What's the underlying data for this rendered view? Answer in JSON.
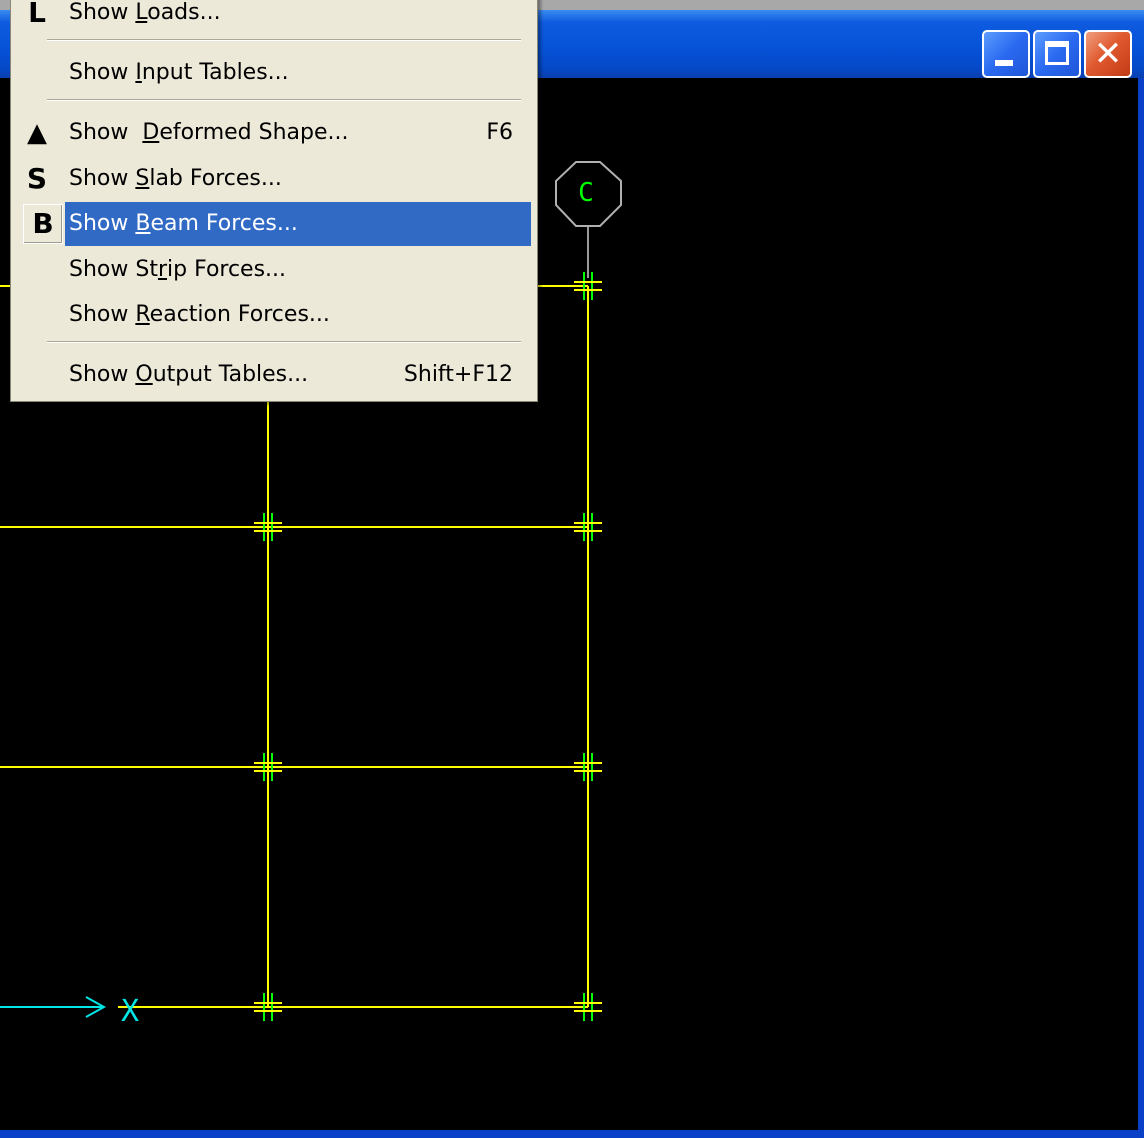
{
  "window": {
    "controls": {
      "minimize": "minimize-icon",
      "maximize": "maximize-icon",
      "close": "close-icon"
    }
  },
  "menu": {
    "items": [
      {
        "pre": "Show ",
        "ul": "L",
        "post": "oads...",
        "shortcut": "",
        "icon": "L"
      },
      {
        "pre": "Show ",
        "ul": "I",
        "post": "nput Tables...",
        "shortcut": "",
        "icon": ""
      },
      {
        "pre": "Show  ",
        "ul": "D",
        "post": "eformed Shape...",
        "shortcut": "F6",
        "icon": "▲"
      },
      {
        "pre": "Show ",
        "ul": "S",
        "post": "lab Forces...",
        "shortcut": "",
        "icon": "S"
      },
      {
        "pre": "Show ",
        "ul": "B",
        "post": "eam Forces...",
        "shortcut": "",
        "icon": "B"
      },
      {
        "pre": "Show St",
        "ul": "r",
        "post": "ip Forces...",
        "shortcut": "",
        "icon": ""
      },
      {
        "pre": "Show ",
        "ul": "R",
        "post": "eaction Forces...",
        "shortcut": "",
        "icon": ""
      },
      {
        "pre": "Show ",
        "ul": "O",
        "post": "utput Tables...",
        "shortcut": "Shift+F12",
        "icon": ""
      }
    ],
    "highlighted_index": 4
  },
  "canvas": {
    "grid_label": "C",
    "axis_label": "X",
    "colors": {
      "background": "#000000",
      "gridline": "#ffff00",
      "axis": "#00e5e5",
      "bubble_text": "#00ff00",
      "bubble_outline": "#b0b0b0"
    }
  }
}
